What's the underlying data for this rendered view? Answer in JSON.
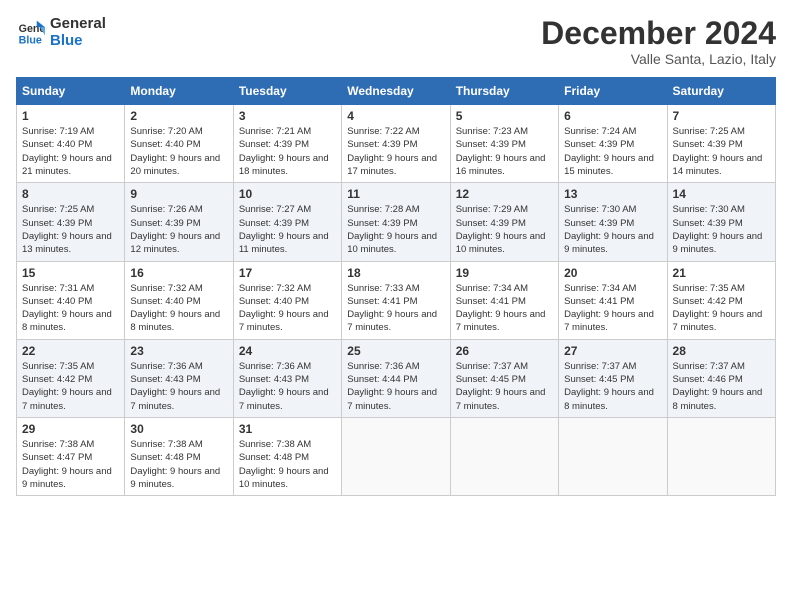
{
  "header": {
    "logo_line1": "General",
    "logo_line2": "Blue",
    "month": "December 2024",
    "location": "Valle Santa, Lazio, Italy"
  },
  "days_of_week": [
    "Sunday",
    "Monday",
    "Tuesday",
    "Wednesday",
    "Thursday",
    "Friday",
    "Saturday"
  ],
  "weeks": [
    [
      {
        "day": "1",
        "sunrise": "7:19 AM",
        "sunset": "4:40 PM",
        "daylight": "9 hours and 21 minutes."
      },
      {
        "day": "2",
        "sunrise": "7:20 AM",
        "sunset": "4:40 PM",
        "daylight": "9 hours and 20 minutes."
      },
      {
        "day": "3",
        "sunrise": "7:21 AM",
        "sunset": "4:39 PM",
        "daylight": "9 hours and 18 minutes."
      },
      {
        "day": "4",
        "sunrise": "7:22 AM",
        "sunset": "4:39 PM",
        "daylight": "9 hours and 17 minutes."
      },
      {
        "day": "5",
        "sunrise": "7:23 AM",
        "sunset": "4:39 PM",
        "daylight": "9 hours and 16 minutes."
      },
      {
        "day": "6",
        "sunrise": "7:24 AM",
        "sunset": "4:39 PM",
        "daylight": "9 hours and 15 minutes."
      },
      {
        "day": "7",
        "sunrise": "7:25 AM",
        "sunset": "4:39 PM",
        "daylight": "9 hours and 14 minutes."
      }
    ],
    [
      {
        "day": "8",
        "sunrise": "7:25 AM",
        "sunset": "4:39 PM",
        "daylight": "9 hours and 13 minutes."
      },
      {
        "day": "9",
        "sunrise": "7:26 AM",
        "sunset": "4:39 PM",
        "daylight": "9 hours and 12 minutes."
      },
      {
        "day": "10",
        "sunrise": "7:27 AM",
        "sunset": "4:39 PM",
        "daylight": "9 hours and 11 minutes."
      },
      {
        "day": "11",
        "sunrise": "7:28 AM",
        "sunset": "4:39 PM",
        "daylight": "9 hours and 10 minutes."
      },
      {
        "day": "12",
        "sunrise": "7:29 AM",
        "sunset": "4:39 PM",
        "daylight": "9 hours and 10 minutes."
      },
      {
        "day": "13",
        "sunrise": "7:30 AM",
        "sunset": "4:39 PM",
        "daylight": "9 hours and 9 minutes."
      },
      {
        "day": "14",
        "sunrise": "7:30 AM",
        "sunset": "4:39 PM",
        "daylight": "9 hours and 9 minutes."
      }
    ],
    [
      {
        "day": "15",
        "sunrise": "7:31 AM",
        "sunset": "4:40 PM",
        "daylight": "9 hours and 8 minutes."
      },
      {
        "day": "16",
        "sunrise": "7:32 AM",
        "sunset": "4:40 PM",
        "daylight": "9 hours and 8 minutes."
      },
      {
        "day": "17",
        "sunrise": "7:32 AM",
        "sunset": "4:40 PM",
        "daylight": "9 hours and 7 minutes."
      },
      {
        "day": "18",
        "sunrise": "7:33 AM",
        "sunset": "4:41 PM",
        "daylight": "9 hours and 7 minutes."
      },
      {
        "day": "19",
        "sunrise": "7:34 AM",
        "sunset": "4:41 PM",
        "daylight": "9 hours and 7 minutes."
      },
      {
        "day": "20",
        "sunrise": "7:34 AM",
        "sunset": "4:41 PM",
        "daylight": "9 hours and 7 minutes."
      },
      {
        "day": "21",
        "sunrise": "7:35 AM",
        "sunset": "4:42 PM",
        "daylight": "9 hours and 7 minutes."
      }
    ],
    [
      {
        "day": "22",
        "sunrise": "7:35 AM",
        "sunset": "4:42 PM",
        "daylight": "9 hours and 7 minutes."
      },
      {
        "day": "23",
        "sunrise": "7:36 AM",
        "sunset": "4:43 PM",
        "daylight": "9 hours and 7 minutes."
      },
      {
        "day": "24",
        "sunrise": "7:36 AM",
        "sunset": "4:43 PM",
        "daylight": "9 hours and 7 minutes."
      },
      {
        "day": "25",
        "sunrise": "7:36 AM",
        "sunset": "4:44 PM",
        "daylight": "9 hours and 7 minutes."
      },
      {
        "day": "26",
        "sunrise": "7:37 AM",
        "sunset": "4:45 PM",
        "daylight": "9 hours and 7 minutes."
      },
      {
        "day": "27",
        "sunrise": "7:37 AM",
        "sunset": "4:45 PM",
        "daylight": "9 hours and 8 minutes."
      },
      {
        "day": "28",
        "sunrise": "7:37 AM",
        "sunset": "4:46 PM",
        "daylight": "9 hours and 8 minutes."
      }
    ],
    [
      {
        "day": "29",
        "sunrise": "7:38 AM",
        "sunset": "4:47 PM",
        "daylight": "9 hours and 9 minutes."
      },
      {
        "day": "30",
        "sunrise": "7:38 AM",
        "sunset": "4:48 PM",
        "daylight": "9 hours and 9 minutes."
      },
      {
        "day": "31",
        "sunrise": "7:38 AM",
        "sunset": "4:48 PM",
        "daylight": "9 hours and 10 minutes."
      },
      null,
      null,
      null,
      null
    ]
  ]
}
